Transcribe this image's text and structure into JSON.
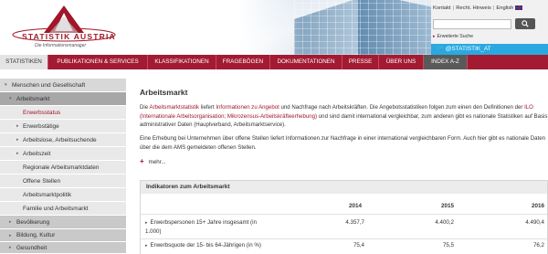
{
  "header": {
    "logo_brand": "STATISTIK AUSTRIA",
    "logo_tagline": "Die Informationsmanager",
    "top_links": [
      "Kontakt",
      "Recht. Hinweis",
      "English"
    ],
    "search_placeholder": "",
    "search_button_icon": "search-icon",
    "advanced_search": "Erweiterte Suche",
    "twitter_handle": "@STATISTIK_AT",
    "twitter_icon": "twitter-bird-icon"
  },
  "nav": {
    "items": [
      "STATISTIKEN",
      "PUBLIKATIONEN & SERVICES",
      "KLASSIFIKATIONEN",
      "FRAGEBÖGEN",
      "DOKUMENTATIONEN",
      "PRESSE",
      "ÜBER UNS",
      "INDEX A-Z"
    ],
    "active_index": 0
  },
  "sidebar": {
    "items": [
      "Menschen und Gesellschaft",
      "Arbeitsmarkt",
      "Erwerbsstatus",
      "Erwerbstätige",
      "Arbeitslose, Arbeitsuchende",
      "Arbeitszeit",
      "Regionale Arbeitsmarktdaten",
      "Offene Stellen",
      "Arbeitsmarktpolitik",
      "Familie und Arbeitsmarkt",
      "Bevölkerung",
      "Bildung, Kultur",
      "Gesundheit"
    ]
  },
  "content": {
    "title": "Arbeitsmarkt",
    "p1_a": "Die ",
    "p1_link1": "Arbeitsmarktstatistik",
    "p1_b": " liefert ",
    "p1_link2": "Informationen zu Angebot",
    "p1_c": " und Nachfrage nach Arbeitskräften. Die Angebotsstatistiken folgen zum einen den Definitionen der ",
    "p1_link3": "ILO (Internationale Arbeitsorganisation; Mikrozensus-Arbeitskräfteerhebung)",
    "p1_d": " und sind damit international vergleichbar, zum anderen gibt es nationale Statistiken auf Basis administrativer Daten (Hauptverband, Arbeitsmarktservice).",
    "p2": "Eine Erhebung bei Unternehmen über offene Stellen liefert Informationen zur Nachfrage in einer international vergleichbaren Form. Auch hier gibt es nationale Daten über die dem AMS gemeldeten offenen Stellen.",
    "more": "mehr..."
  },
  "indicators": {
    "title": "Indikatoren zum Arbeitsmarkt",
    "years": [
      "2014",
      "2015",
      "2016"
    ],
    "rows": [
      {
        "label_line1": "Erwerbspersonen 15+ Jahre insgesamt (in",
        "label_line2": "1.000)",
        "values": [
          "4.357,7",
          "4.400,2",
          "4.490,4"
        ]
      },
      {
        "label_line1": "Erwerbsquote der 15- bis 64-Jährigen (in %)",
        "label_line2": "",
        "values": [
          "75,4",
          "75,5",
          "76,2"
        ]
      }
    ]
  },
  "colors": {
    "brand": "#a21b32",
    "accent_text": "#a01729",
    "twitter": "#2aa9e0"
  }
}
